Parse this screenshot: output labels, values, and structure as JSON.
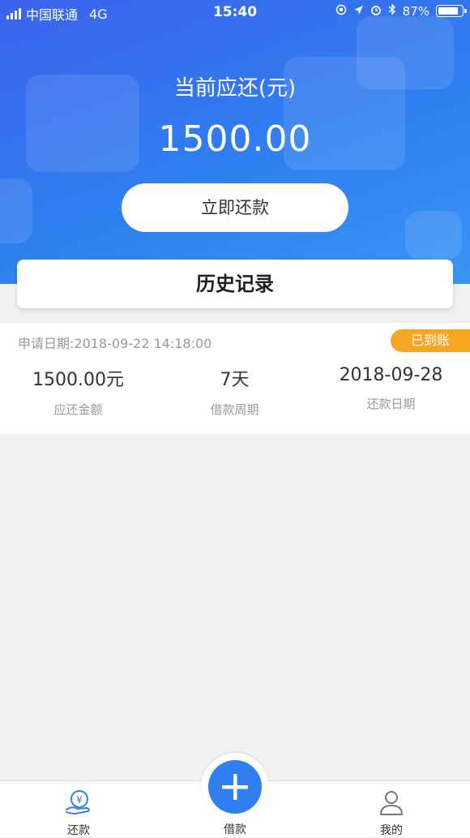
{
  "status_bar": {
    "carrier": "中国联通",
    "network": "4G",
    "time": "15:40",
    "battery": "87%",
    "battery_level": 0.87
  },
  "hero": {
    "due_label": "当前应还(元)",
    "due_amount": "1500.00",
    "repay_button": "立即还款"
  },
  "history": {
    "title": "历史记录"
  },
  "record": {
    "apply_date": "申请日期:2018-09-22 14:18:00",
    "status_badge": "已到账",
    "amount_value": "1500.00元",
    "amount_label": "应还金额",
    "period_value": "7天",
    "period_label": "借款周期",
    "repay_date_value": "2018-09-28",
    "repay_date_label": "还款日期"
  },
  "bottom_nav": {
    "items": [
      {
        "label": "还款",
        "icon": "repay-icon"
      },
      {
        "label": "借款",
        "icon": "plus-icon"
      },
      {
        "label": "我的",
        "icon": "user-icon"
      }
    ]
  },
  "colors": {
    "primary": "#2f7ff0",
    "badge": "#f6a623",
    "page_bg": "#f1f1f1"
  }
}
